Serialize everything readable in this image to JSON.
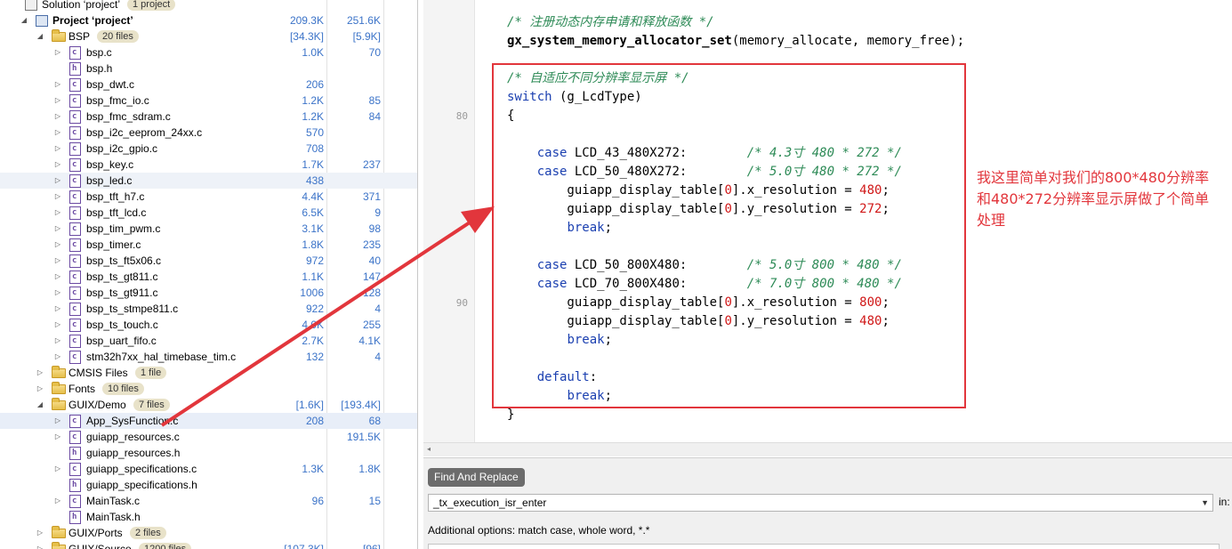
{
  "tree": {
    "rows": [
      {
        "label": "Solution ‘project’",
        "badge": "1 project",
        "type": "solution",
        "expand": "",
        "indent": 0,
        "v1": "",
        "v2": ""
      },
      {
        "label": "Project ‘project’",
        "badge": "",
        "type": "project",
        "expand": "◢",
        "indent": 1,
        "v1": "209.3K",
        "v2": "251.6K",
        "bold": true
      },
      {
        "label": "BSP",
        "badge": "20 files",
        "type": "folder",
        "expand": "◢",
        "indent": 2,
        "v1": "[34.3K]",
        "v2": "[5.9K]"
      },
      {
        "label": "bsp.c",
        "type": "c",
        "expand": "▷",
        "indent": 3,
        "v1": "1.0K",
        "v2": "70"
      },
      {
        "label": "bsp.h",
        "type": "h",
        "expand": "",
        "indent": 3,
        "v1": "",
        "v2": ""
      },
      {
        "label": "bsp_dwt.c",
        "type": "c",
        "expand": "▷",
        "indent": 3,
        "v1": "206",
        "v2": ""
      },
      {
        "label": "bsp_fmc_io.c",
        "type": "c",
        "expand": "▷",
        "indent": 3,
        "v1": "1.2K",
        "v2": "85"
      },
      {
        "label": "bsp_fmc_sdram.c",
        "type": "c",
        "expand": "▷",
        "indent": 3,
        "v1": "1.2K",
        "v2": "84"
      },
      {
        "label": "bsp_i2c_eeprom_24xx.c",
        "type": "c",
        "expand": "▷",
        "indent": 3,
        "v1": "570",
        "v2": ""
      },
      {
        "label": "bsp_i2c_gpio.c",
        "type": "c",
        "expand": "▷",
        "indent": 3,
        "v1": "708",
        "v2": ""
      },
      {
        "label": "bsp_key.c",
        "type": "c",
        "expand": "▷",
        "indent": 3,
        "v1": "1.7K",
        "v2": "237"
      },
      {
        "label": "bsp_led.c",
        "type": "c",
        "expand": "▷",
        "indent": 3,
        "v1": "438",
        "v2": "",
        "hl": true
      },
      {
        "label": "bsp_tft_h7.c",
        "type": "c",
        "expand": "▷",
        "indent": 3,
        "v1": "4.4K",
        "v2": "371"
      },
      {
        "label": "bsp_tft_lcd.c",
        "type": "c",
        "expand": "▷",
        "indent": 3,
        "v1": "6.5K",
        "v2": "9"
      },
      {
        "label": "bsp_tim_pwm.c",
        "type": "c",
        "expand": "▷",
        "indent": 3,
        "v1": "3.1K",
        "v2": "98"
      },
      {
        "label": "bsp_timer.c",
        "type": "c",
        "expand": "▷",
        "indent": 3,
        "v1": "1.8K",
        "v2": "235"
      },
      {
        "label": "bsp_ts_ft5x06.c",
        "type": "c",
        "expand": "▷",
        "indent": 3,
        "v1": "972",
        "v2": "40"
      },
      {
        "label": "bsp_ts_gt811.c",
        "type": "c",
        "expand": "▷",
        "indent": 3,
        "v1": "1.1K",
        "v2": "147"
      },
      {
        "label": "bsp_ts_gt911.c",
        "type": "c",
        "expand": "▷",
        "indent": 3,
        "v1": "1006",
        "v2": "128"
      },
      {
        "label": "bsp_ts_stmpe811.c",
        "type": "c",
        "expand": "▷",
        "indent": 3,
        "v1": "922",
        "v2": "4"
      },
      {
        "label": "bsp_ts_touch.c",
        "type": "c",
        "expand": "▷",
        "indent": 3,
        "v1": "4.0K",
        "v2": "255"
      },
      {
        "label": "bsp_uart_fifo.c",
        "type": "c",
        "expand": "▷",
        "indent": 3,
        "v1": "2.7K",
        "v2": "4.1K"
      },
      {
        "label": "stm32h7xx_hal_timebase_tim.c",
        "type": "c",
        "expand": "▷",
        "indent": 3,
        "v1": "132",
        "v2": "4"
      },
      {
        "label": "CMSIS Files",
        "badge": "1 file",
        "type": "folder",
        "expand": "▷",
        "indent": 2,
        "v1": "",
        "v2": ""
      },
      {
        "label": "Fonts",
        "badge": "10 files",
        "type": "folder",
        "expand": "▷",
        "indent": 2,
        "v1": "",
        "v2": ""
      },
      {
        "label": "GUIX/Demo",
        "badge": "7 files",
        "type": "folder",
        "expand": "◢",
        "indent": 2,
        "v1": "[1.6K]",
        "v2": "[193.4K]"
      },
      {
        "label": "App_SysFunction.c",
        "type": "c",
        "expand": "▷",
        "indent": 3,
        "v1": "208",
        "v2": "68",
        "selected": true
      },
      {
        "label": "guiapp_resources.c",
        "type": "c",
        "expand": "▷",
        "indent": 3,
        "v1": "",
        "v2": "191.5K"
      },
      {
        "label": "guiapp_resources.h",
        "type": "h",
        "expand": "",
        "indent": 3,
        "v1": "",
        "v2": ""
      },
      {
        "label": "guiapp_specifications.c",
        "type": "c",
        "expand": "▷",
        "indent": 3,
        "v1": "1.3K",
        "v2": "1.8K"
      },
      {
        "label": "guiapp_specifications.h",
        "type": "h",
        "expand": "",
        "indent": 3,
        "v1": "",
        "v2": ""
      },
      {
        "label": "MainTask.c",
        "type": "c",
        "expand": "▷",
        "indent": 3,
        "v1": "96",
        "v2": "15"
      },
      {
        "label": "MainTask.h",
        "type": "h",
        "expand": "",
        "indent": 3,
        "v1": "",
        "v2": ""
      },
      {
        "label": "GUIX/Ports",
        "badge": "2 files",
        "type": "folder",
        "expand": "▷",
        "indent": 2,
        "v1": "",
        "v2": ""
      },
      {
        "label": "GUIX/Source",
        "badge": "1200 files",
        "type": "folder",
        "expand": "▷",
        "indent": 2,
        "v1": "[107.3K]",
        "v2": "[96]"
      }
    ]
  },
  "editor": {
    "line_numbers": [
      {
        "text": "80",
        "line": 5
      },
      {
        "text": "90",
        "line": 15
      }
    ],
    "lines": [
      [
        {
          "t": "/* 注册动态内存申请和释放函数 */",
          "c": "cm"
        }
      ],
      [
        {
          "t": "gx_system_memory_allocator_set",
          "c": "fn"
        },
        {
          "t": "(memory_allocate, memory_free);",
          "c": ""
        }
      ],
      [
        {
          "t": "",
          "c": ""
        }
      ],
      [
        {
          "t": "/* 自适应不同分辨率显示屏 */",
          "c": "cm"
        }
      ],
      [
        {
          "t": "switch",
          "c": "kw"
        },
        {
          "t": " (g_LcdType)",
          "c": ""
        }
      ],
      [
        {
          "t": "{",
          "c": ""
        }
      ],
      [
        {
          "t": "",
          "c": ""
        }
      ],
      [
        {
          "t": "    ",
          "c": ""
        },
        {
          "t": "case",
          "c": "kw"
        },
        {
          "t": " LCD_43_480X272:        ",
          "c": ""
        },
        {
          "t": "/* 4.3寸 480 * 272 */",
          "c": "cm"
        }
      ],
      [
        {
          "t": "    ",
          "c": ""
        },
        {
          "t": "case",
          "c": "kw"
        },
        {
          "t": " LCD_50_480X272:        ",
          "c": ""
        },
        {
          "t": "/* 5.0寸 480 * 272 */",
          "c": "cm"
        }
      ],
      [
        {
          "t": "        guiapp_display_table[",
          "c": ""
        },
        {
          "t": "0",
          "c": "num"
        },
        {
          "t": "].x_resolution = ",
          "c": ""
        },
        {
          "t": "480",
          "c": "num"
        },
        {
          "t": ";",
          "c": ""
        }
      ],
      [
        {
          "t": "        guiapp_display_table[",
          "c": ""
        },
        {
          "t": "0",
          "c": "num"
        },
        {
          "t": "].y_resolution = ",
          "c": ""
        },
        {
          "t": "272",
          "c": "num"
        },
        {
          "t": ";",
          "c": ""
        }
      ],
      [
        {
          "t": "        ",
          "c": ""
        },
        {
          "t": "break",
          "c": "kw"
        },
        {
          "t": ";",
          "c": ""
        }
      ],
      [
        {
          "t": "",
          "c": ""
        }
      ],
      [
        {
          "t": "    ",
          "c": ""
        },
        {
          "t": "case",
          "c": "kw"
        },
        {
          "t": " LCD_50_800X480:        ",
          "c": ""
        },
        {
          "t": "/* 5.0寸 800 * 480 */",
          "c": "cm"
        }
      ],
      [
        {
          "t": "    ",
          "c": ""
        },
        {
          "t": "case",
          "c": "kw"
        },
        {
          "t": " LCD_70_800X480:        ",
          "c": ""
        },
        {
          "t": "/* 7.0寸 800 * 480 */",
          "c": "cm"
        }
      ],
      [
        {
          "t": "        guiapp_display_table[",
          "c": ""
        },
        {
          "t": "0",
          "c": "num"
        },
        {
          "t": "].x_resolution = ",
          "c": ""
        },
        {
          "t": "800",
          "c": "num"
        },
        {
          "t": ";",
          "c": ""
        }
      ],
      [
        {
          "t": "        guiapp_display_table[",
          "c": ""
        },
        {
          "t": "0",
          "c": "num"
        },
        {
          "t": "].y_resolution = ",
          "c": ""
        },
        {
          "t": "480",
          "c": "num"
        },
        {
          "t": ";",
          "c": ""
        }
      ],
      [
        {
          "t": "        ",
          "c": ""
        },
        {
          "t": "break",
          "c": "kw"
        },
        {
          "t": ";",
          "c": ""
        }
      ],
      [
        {
          "t": "",
          "c": ""
        }
      ],
      [
        {
          "t": "    ",
          "c": ""
        },
        {
          "t": "default",
          "c": "kw"
        },
        {
          "t": ":",
          "c": ""
        }
      ],
      [
        {
          "t": "        ",
          "c": ""
        },
        {
          "t": "break",
          "c": "kw"
        },
        {
          "t": ";",
          "c": ""
        }
      ],
      [
        {
          "t": "}",
          "c": ""
        }
      ]
    ],
    "scroll_left_icon": "◂"
  },
  "annotation": {
    "note": "我这里简单对我们的800*480分辨率和480*272分辨率显示屏做了个简单处理",
    "color": "#e2363c"
  },
  "find_panel": {
    "title": "Find And Replace",
    "search_value": "_tx_execution_isr_enter",
    "dropdown_icon": "▼",
    "in_label": "in:",
    "options_text": "Additional options: match case, whole word, *.*"
  },
  "colors": {
    "comment": "#2e8b57",
    "keyword": "#1a3fb0",
    "number": "#d01818",
    "size_value": "#3b73c8",
    "badge_bg": "#e8e2c9"
  }
}
